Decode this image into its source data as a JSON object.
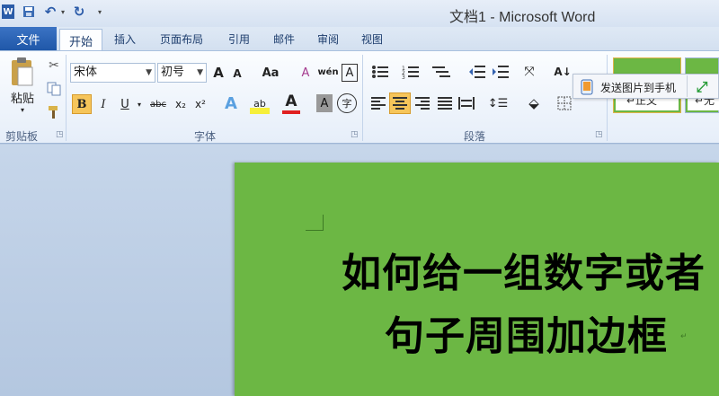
{
  "window": {
    "title": "文档1 - Microsoft Word"
  },
  "quick_access": {
    "icons": [
      "word-icon",
      "save-icon",
      "undo-icon",
      "redo-icon",
      "customize-icon"
    ]
  },
  "tabs": [
    "文件",
    "开始",
    "插入",
    "页面布局",
    "引用",
    "邮件",
    "审阅",
    "视图"
  ],
  "clipboard": {
    "paste_label": "粘贴",
    "group_label": "剪贴板"
  },
  "font": {
    "font_name": "宋体",
    "font_size": "初号",
    "grow": "A",
    "shrink": "A",
    "change_case": "Aa",
    "clear_format": "A",
    "bold": "B",
    "italic": "I",
    "underline": "U",
    "strike": "abc",
    "subscript": "x₂",
    "superscript": "x²",
    "effects": "A",
    "highlight": "ab",
    "color": "A",
    "shading": "A",
    "enclose": "字",
    "phonetic": "wén",
    "border": "A",
    "group_label": "字体"
  },
  "paragraph": {
    "group_label": "段落"
  },
  "styles": {
    "normal_label": "↵正文",
    "nospace_label": "↵无"
  },
  "popup": {
    "label": "发送图片到手机"
  },
  "document": {
    "line1": "如何给一组数字或者",
    "line2": "句子周围加边框"
  },
  "colors": {
    "page": "#6cb744",
    "accent": "#2b579a"
  }
}
